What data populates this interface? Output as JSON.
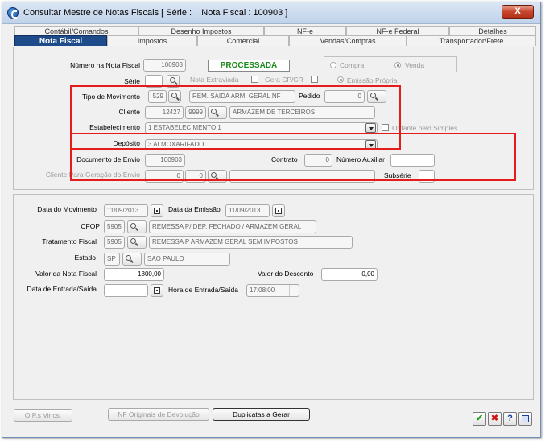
{
  "window": {
    "title": "Consultar Mestre de Notas Fiscais [ Série :    Nota Fiscal : 100903 ]",
    "close": "X"
  },
  "tabs_back": [
    "Contábil/Comandos",
    "Desenho Impostos",
    "NF-e",
    "NF-e Federal",
    "Detalhes"
  ],
  "tabs_front": [
    "Nota Fiscal",
    "Impostos",
    "Comercial",
    "Vendas/Compras",
    "Transportador/Frete"
  ],
  "header": {
    "numero_label": "Número na Nota Fiscal",
    "numero_value": "100903",
    "status": "PROCESSADA",
    "compra_label": "Compra",
    "venda_label": "Venda",
    "serie_label": "Série",
    "serie_value": "",
    "nota_extraviada_label": "Nota Extraviada",
    "gera_cp_label": "Gera CP/CR",
    "emissao_propria_label": "Emissão Própria",
    "tipo_mov_label": "Tipo de Movimento",
    "tipo_mov_code": "529",
    "tipo_mov_desc": "REM. SAIDA ARM. GERAL NF",
    "pedido_label": "Pedido",
    "pedido_value": "0",
    "cliente_label": "Cliente",
    "cliente_code": "12427",
    "cliente_sub": "9999",
    "cliente_name": "ARMAZEM DE TERCEIROS",
    "estabelecimento_label": "Estabelecimento",
    "estabelecimento_value": "1 ESTABELECIMENTO 1",
    "optante_label": "Optante pelo Simples",
    "deposito_label": "Depósito",
    "deposito_value": "3 ALMOXARIFADO",
    "doc_envio_label": "Documento de Envio",
    "doc_envio_value": "100903",
    "contrato_label": "Contrato",
    "contrato_value": "0",
    "num_aux_label": "Número Auxiliar",
    "num_aux_value": "",
    "cliente_geracao_label": "Cliente Para Geração do Envio",
    "cliente_geracao_a": "0",
    "cliente_geracao_b": "0",
    "cliente_geracao_name": "",
    "subserie_label": "Subsérie",
    "subserie_value": ""
  },
  "details": {
    "data_mov_label": "Data do Movimento",
    "data_mov_value": "11/09/2013",
    "data_emissao_label": "Data da Emissão",
    "data_emissao_value": "11/09/2013",
    "cfop_label": "CFOP",
    "cfop_code": "5905",
    "cfop_desc": "REMESSA P/ DEP. FECHADO / ARMAZEM GERAL",
    "trat_label": "Tratamento Fiscal",
    "trat_code": "5905",
    "trat_desc": "REMESSA P ARMAZEM GERAL SEM IMPOSTOS",
    "estado_label": "Estado",
    "estado_code": "SP",
    "estado_name": "SAO PAULO",
    "valor_nf_label": "Valor da Nota Fiscal",
    "valor_nf_value": "1800,00",
    "valor_desc_label": "Valor do Desconto",
    "valor_desc_value": "0,00",
    "data_es_label": "Data de Entrada/Saída",
    "data_es_value": "",
    "hora_es_label": "Hora de Entrada/Saída",
    "hora_es_value": "17:08:00"
  },
  "footer": {
    "ops": "O.P.s Vincs.",
    "nf_orig": "NF Originais de  Devolução",
    "duplicatas": "Duplicatas a Gerar",
    "ok": "✔",
    "cancel": "✖",
    "help": "?"
  },
  "colors": {
    "status_green": "#1a8a1a",
    "highlight_red": "#e51c1c",
    "active_tab": "#1e4b8a"
  }
}
